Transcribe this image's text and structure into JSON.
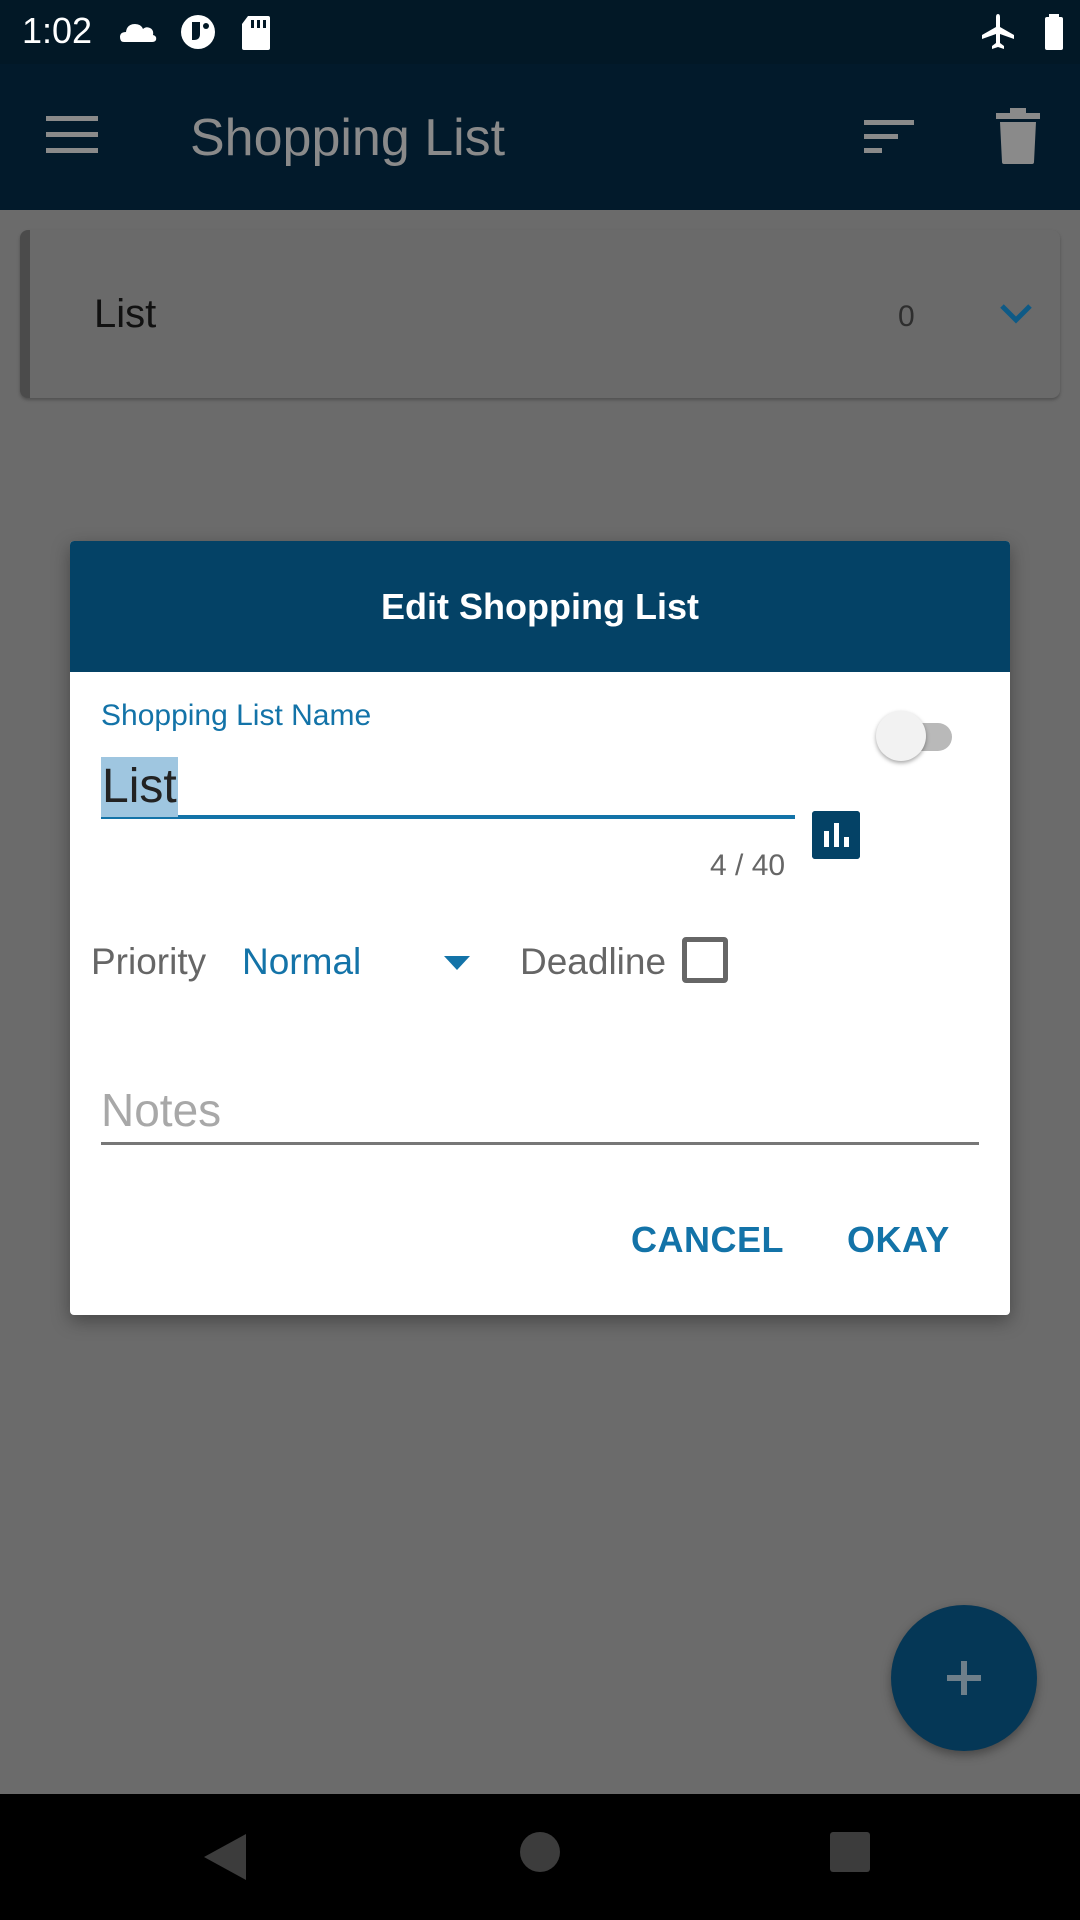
{
  "status_bar": {
    "time": "1:02",
    "icons": [
      "cloud-icon",
      "cookie-icon",
      "sd-card-icon",
      "airplane-mode-icon",
      "battery-icon"
    ]
  },
  "app_bar": {
    "title": "Shopping List",
    "icons": [
      "menu-icon",
      "sort-icon",
      "trash-icon"
    ]
  },
  "list_card": {
    "title": "List",
    "count": "0",
    "expand_icon": "chevron-down-icon"
  },
  "dialog": {
    "title": "Edit Shopping List",
    "name_field": {
      "label": "Shopping List Name",
      "value": "List",
      "counter": "4 / 40"
    },
    "toggle_on": false,
    "priority": {
      "label": "Priority",
      "value": "Normal"
    },
    "deadline": {
      "label": "Deadline",
      "checked": false
    },
    "notes": {
      "placeholder": "Notes"
    },
    "buttons": {
      "cancel": "CANCEL",
      "okay": "OKAY"
    }
  },
  "fab": {
    "icon": "plus-icon"
  },
  "colors": {
    "primary_dark": "#021a2b",
    "dialog_header": "#044266",
    "accent": "#1373a8",
    "selection": "#9fc6e0",
    "scrim_background": "#6b6b6b"
  }
}
